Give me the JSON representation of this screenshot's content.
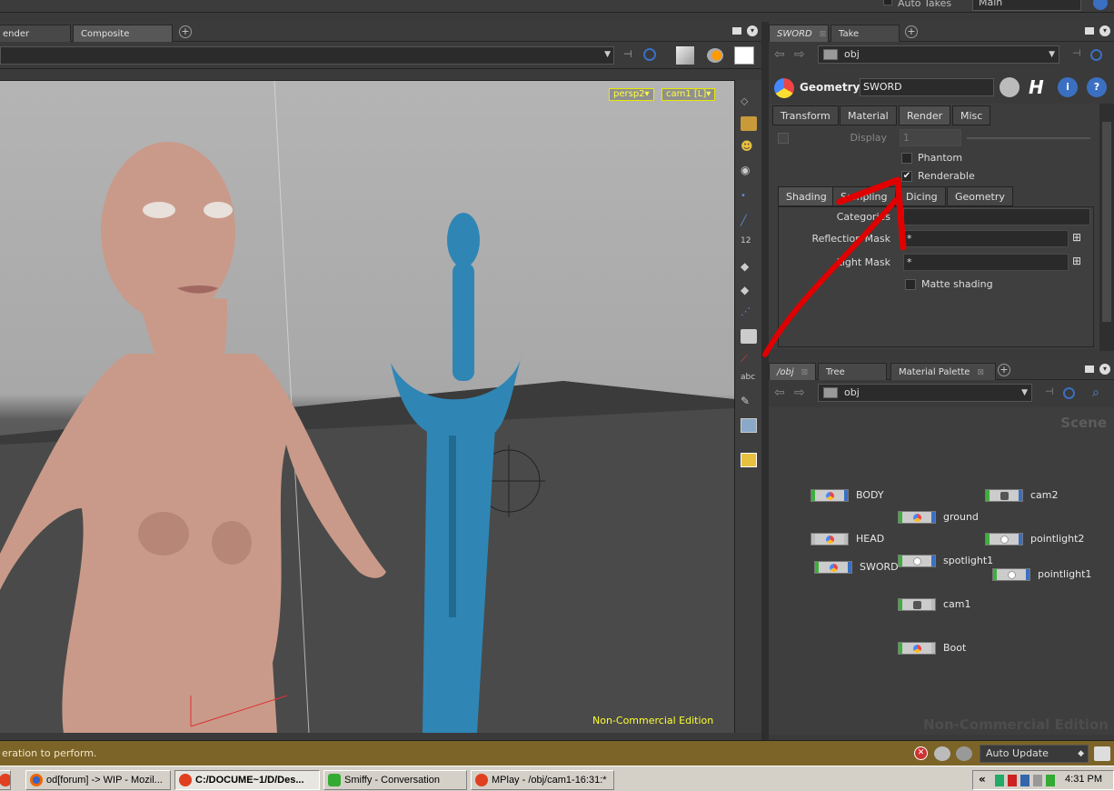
{
  "topbar": {
    "auto_takes_label": "Auto Takes",
    "take_value": "Main"
  },
  "left_pane": {
    "tabs": [
      {
        "label": "ender View"
      },
      {
        "label": "Composite View"
      }
    ]
  },
  "viewport": {
    "camera_menu": "persp2▾",
    "view_menu": "cam1 [L]▾",
    "watermark": "Non-Commercial Edition"
  },
  "right_pane": {
    "tabs": [
      {
        "label": "SWORD"
      },
      {
        "label": "Take List"
      }
    ],
    "path": "obj"
  },
  "params": {
    "node_type": "Geometry",
    "node_name": "SWORD",
    "tabs": [
      "Transform",
      "Material",
      "Render",
      "Misc"
    ],
    "display_label": "Display",
    "display_value": "1",
    "phantom_label": "Phantom",
    "renderable_label": "Renderable",
    "subtabs": [
      "Shading",
      "Sampling",
      "Dicing",
      "Geometry"
    ],
    "categories_label": "Categories",
    "categories_value": "",
    "reflection_mask_label": "Reflection Mask",
    "reflection_mask_value": "*",
    "light_mask_label": "Light Mask",
    "light_mask_value": "*",
    "matte_label": "Matte shading"
  },
  "network": {
    "tabs": [
      {
        "label": "/obj"
      },
      {
        "label": "Tree View"
      },
      {
        "label": "Material Palette"
      }
    ],
    "path": "obj",
    "context_label": "Scene",
    "watermark": "Non-Commercial Edition",
    "nodes": [
      {
        "label": "BODY",
        "kind": "geo"
      },
      {
        "label": "cam2",
        "kind": "cam"
      },
      {
        "label": "ground",
        "kind": "geo"
      },
      {
        "label": "HEAD",
        "kind": "geo"
      },
      {
        "label": "pointlight2",
        "kind": "light"
      },
      {
        "label": "spotlight1",
        "kind": "light"
      },
      {
        "label": "SWORD",
        "kind": "geo"
      },
      {
        "label": "pointlight1",
        "kind": "light"
      },
      {
        "label": "cam1",
        "kind": "cam"
      },
      {
        "label": "Boot",
        "kind": "geo"
      }
    ]
  },
  "status": {
    "message": "eration to perform.",
    "update_mode": "Auto Update"
  },
  "taskbar": {
    "items": [
      {
        "label": "od[forum] -> WIP - Mozil..."
      },
      {
        "label": "C:/DOCUME~1/D/Des..."
      },
      {
        "label": "Smiffy - Conversation"
      },
      {
        "label": "MPlay - /obj/cam1-16:31:*"
      }
    ],
    "clock": "4:31 PM"
  },
  "colors": {
    "accent_blue": "#3a6fc2",
    "status_bar": "#7c6428",
    "viewport_label": "#ffff40",
    "annotation_red": "#e00000"
  }
}
